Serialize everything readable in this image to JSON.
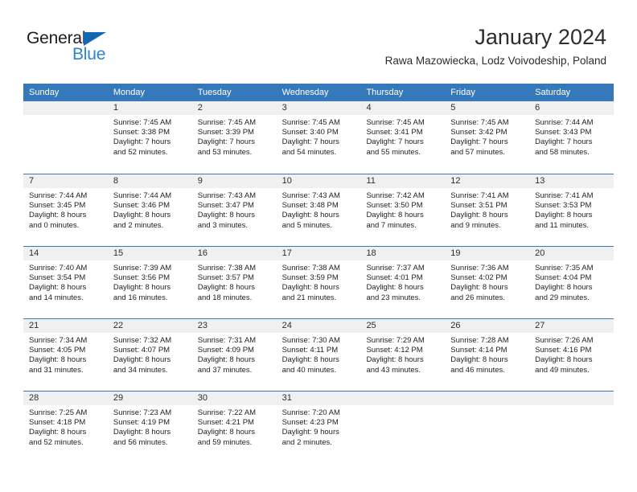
{
  "brand": {
    "name_primary": "General",
    "name_secondary": "Blue",
    "logo_icon": "triangle-flag-icon",
    "primary_color": "#1268b3",
    "secondary_color": "#2a85d0"
  },
  "header": {
    "title": "January 2024",
    "subtitle": "Rawa Mazowiecka, Lodz Voivodeship, Poland"
  },
  "calendar": {
    "header_bg": "#3579bb",
    "daynum_bg": "#f0f0f0",
    "weekdays": [
      "Sunday",
      "Monday",
      "Tuesday",
      "Wednesday",
      "Thursday",
      "Friday",
      "Saturday"
    ],
    "weeks": [
      [
        {
          "day": "",
          "lines": []
        },
        {
          "day": "1",
          "lines": [
            "Sunrise: 7:45 AM",
            "Sunset: 3:38 PM",
            "Daylight: 7 hours",
            "and 52 minutes."
          ]
        },
        {
          "day": "2",
          "lines": [
            "Sunrise: 7:45 AM",
            "Sunset: 3:39 PM",
            "Daylight: 7 hours",
            "and 53 minutes."
          ]
        },
        {
          "day": "3",
          "lines": [
            "Sunrise: 7:45 AM",
            "Sunset: 3:40 PM",
            "Daylight: 7 hours",
            "and 54 minutes."
          ]
        },
        {
          "day": "4",
          "lines": [
            "Sunrise: 7:45 AM",
            "Sunset: 3:41 PM",
            "Daylight: 7 hours",
            "and 55 minutes."
          ]
        },
        {
          "day": "5",
          "lines": [
            "Sunrise: 7:45 AM",
            "Sunset: 3:42 PM",
            "Daylight: 7 hours",
            "and 57 minutes."
          ]
        },
        {
          "day": "6",
          "lines": [
            "Sunrise: 7:44 AM",
            "Sunset: 3:43 PM",
            "Daylight: 7 hours",
            "and 58 minutes."
          ]
        }
      ],
      [
        {
          "day": "7",
          "lines": [
            "Sunrise: 7:44 AM",
            "Sunset: 3:45 PM",
            "Daylight: 8 hours",
            "and 0 minutes."
          ]
        },
        {
          "day": "8",
          "lines": [
            "Sunrise: 7:44 AM",
            "Sunset: 3:46 PM",
            "Daylight: 8 hours",
            "and 2 minutes."
          ]
        },
        {
          "day": "9",
          "lines": [
            "Sunrise: 7:43 AM",
            "Sunset: 3:47 PM",
            "Daylight: 8 hours",
            "and 3 minutes."
          ]
        },
        {
          "day": "10",
          "lines": [
            "Sunrise: 7:43 AM",
            "Sunset: 3:48 PM",
            "Daylight: 8 hours",
            "and 5 minutes."
          ]
        },
        {
          "day": "11",
          "lines": [
            "Sunrise: 7:42 AM",
            "Sunset: 3:50 PM",
            "Daylight: 8 hours",
            "and 7 minutes."
          ]
        },
        {
          "day": "12",
          "lines": [
            "Sunrise: 7:41 AM",
            "Sunset: 3:51 PM",
            "Daylight: 8 hours",
            "and 9 minutes."
          ]
        },
        {
          "day": "13",
          "lines": [
            "Sunrise: 7:41 AM",
            "Sunset: 3:53 PM",
            "Daylight: 8 hours",
            "and 11 minutes."
          ]
        }
      ],
      [
        {
          "day": "14",
          "lines": [
            "Sunrise: 7:40 AM",
            "Sunset: 3:54 PM",
            "Daylight: 8 hours",
            "and 14 minutes."
          ]
        },
        {
          "day": "15",
          "lines": [
            "Sunrise: 7:39 AM",
            "Sunset: 3:56 PM",
            "Daylight: 8 hours",
            "and 16 minutes."
          ]
        },
        {
          "day": "16",
          "lines": [
            "Sunrise: 7:38 AM",
            "Sunset: 3:57 PM",
            "Daylight: 8 hours",
            "and 18 minutes."
          ]
        },
        {
          "day": "17",
          "lines": [
            "Sunrise: 7:38 AM",
            "Sunset: 3:59 PM",
            "Daylight: 8 hours",
            "and 21 minutes."
          ]
        },
        {
          "day": "18",
          "lines": [
            "Sunrise: 7:37 AM",
            "Sunset: 4:01 PM",
            "Daylight: 8 hours",
            "and 23 minutes."
          ]
        },
        {
          "day": "19",
          "lines": [
            "Sunrise: 7:36 AM",
            "Sunset: 4:02 PM",
            "Daylight: 8 hours",
            "and 26 minutes."
          ]
        },
        {
          "day": "20",
          "lines": [
            "Sunrise: 7:35 AM",
            "Sunset: 4:04 PM",
            "Daylight: 8 hours",
            "and 29 minutes."
          ]
        }
      ],
      [
        {
          "day": "21",
          "lines": [
            "Sunrise: 7:34 AM",
            "Sunset: 4:05 PM",
            "Daylight: 8 hours",
            "and 31 minutes."
          ]
        },
        {
          "day": "22",
          "lines": [
            "Sunrise: 7:32 AM",
            "Sunset: 4:07 PM",
            "Daylight: 8 hours",
            "and 34 minutes."
          ]
        },
        {
          "day": "23",
          "lines": [
            "Sunrise: 7:31 AM",
            "Sunset: 4:09 PM",
            "Daylight: 8 hours",
            "and 37 minutes."
          ]
        },
        {
          "day": "24",
          "lines": [
            "Sunrise: 7:30 AM",
            "Sunset: 4:11 PM",
            "Daylight: 8 hours",
            "and 40 minutes."
          ]
        },
        {
          "day": "25",
          "lines": [
            "Sunrise: 7:29 AM",
            "Sunset: 4:12 PM",
            "Daylight: 8 hours",
            "and 43 minutes."
          ]
        },
        {
          "day": "26",
          "lines": [
            "Sunrise: 7:28 AM",
            "Sunset: 4:14 PM",
            "Daylight: 8 hours",
            "and 46 minutes."
          ]
        },
        {
          "day": "27",
          "lines": [
            "Sunrise: 7:26 AM",
            "Sunset: 4:16 PM",
            "Daylight: 8 hours",
            "and 49 minutes."
          ]
        }
      ],
      [
        {
          "day": "28",
          "lines": [
            "Sunrise: 7:25 AM",
            "Sunset: 4:18 PM",
            "Daylight: 8 hours",
            "and 52 minutes."
          ]
        },
        {
          "day": "29",
          "lines": [
            "Sunrise: 7:23 AM",
            "Sunset: 4:19 PM",
            "Daylight: 8 hours",
            "and 56 minutes."
          ]
        },
        {
          "day": "30",
          "lines": [
            "Sunrise: 7:22 AM",
            "Sunset: 4:21 PM",
            "Daylight: 8 hours",
            "and 59 minutes."
          ]
        },
        {
          "day": "31",
          "lines": [
            "Sunrise: 7:20 AM",
            "Sunset: 4:23 PM",
            "Daylight: 9 hours",
            "and 2 minutes."
          ]
        },
        {
          "day": "",
          "lines": []
        },
        {
          "day": "",
          "lines": []
        },
        {
          "day": "",
          "lines": []
        }
      ]
    ]
  }
}
